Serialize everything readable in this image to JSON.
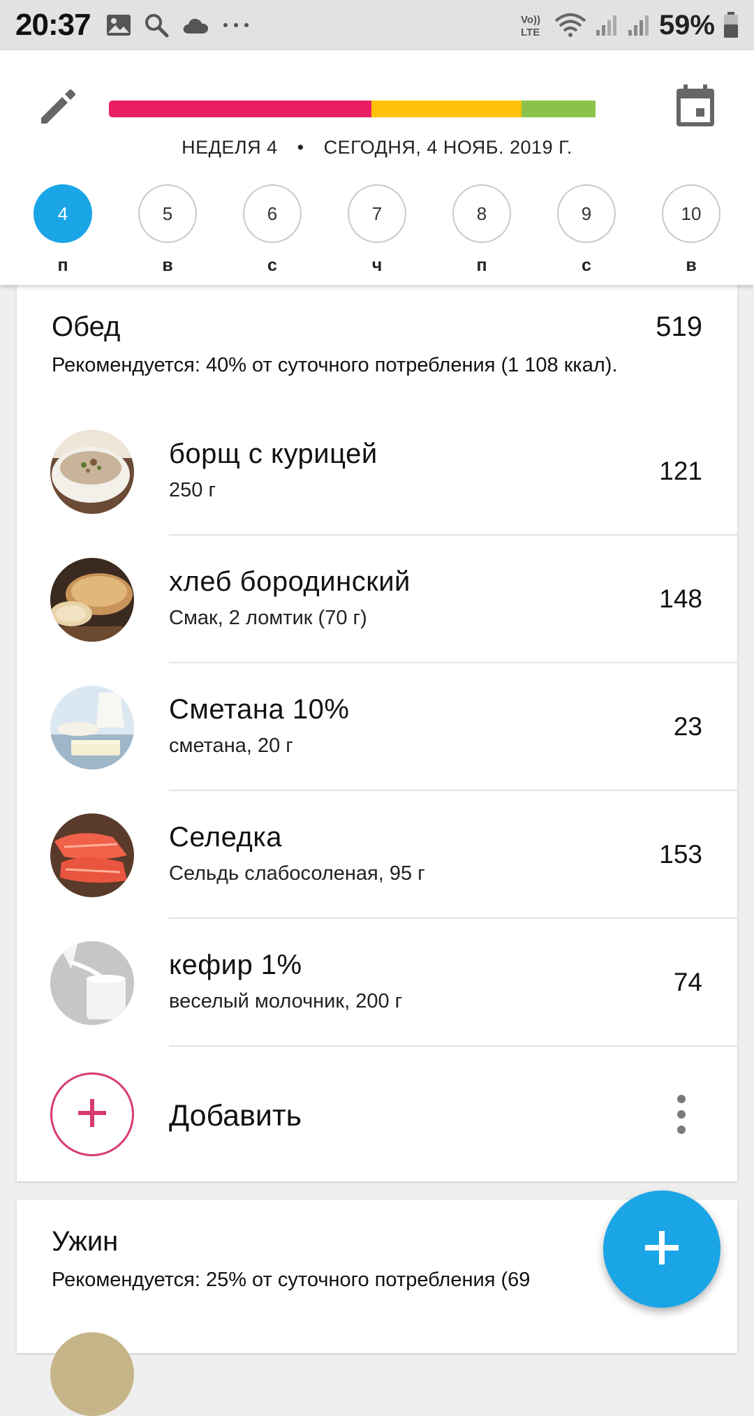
{
  "status_bar": {
    "time": "20:37",
    "battery_text": "59%",
    "network_label": "Vo)) LTE",
    "icons": [
      "image-icon",
      "search-icon",
      "cloud-icon",
      "more-dots-icon",
      "volte-icon",
      "wifi-icon",
      "signal-icon",
      "signal-icon",
      "battery-icon"
    ]
  },
  "header": {
    "edit_icon": "pencil-icon",
    "calendar_icon": "calendar-icon",
    "progress": {
      "segments": [
        {
          "color": "#e91e63",
          "fraction": 0.489
        },
        {
          "color": "#ffc107",
          "fraction": 0.28
        },
        {
          "color": "#8bc34a",
          "fraction": 0.138
        }
      ]
    },
    "week_label": "НЕДЕЛЯ 4",
    "separator": "•",
    "date_label": "СЕГОДНЯ, 4 НОЯБ. 2019 Г.",
    "days": [
      {
        "num": "4",
        "label": "п",
        "active": true
      },
      {
        "num": "5",
        "label": "в",
        "active": false
      },
      {
        "num": "6",
        "label": "с",
        "active": false
      },
      {
        "num": "7",
        "label": "ч",
        "active": false
      },
      {
        "num": "8",
        "label": "п",
        "active": false
      },
      {
        "num": "9",
        "label": "с",
        "active": false
      },
      {
        "num": "10",
        "label": "в",
        "active": false
      }
    ]
  },
  "lunch": {
    "title": "Обед",
    "total": "519",
    "recommendation": "Рекомендуется: 40% от суточного потребления (1 108 ккал).",
    "items": [
      {
        "name": "борщ с курицей",
        "sub": "250 г",
        "value": "121"
      },
      {
        "name": "хлеб бородинский",
        "sub": "Смак, 2 ломтик (70 г)",
        "value": "148"
      },
      {
        "name": "Сметана 10%",
        "sub": "сметана, 20 г",
        "value": "23"
      },
      {
        "name": "Селедка",
        "sub": "Сельдь слабосоленая, 95 г",
        "value": "153"
      },
      {
        "name": "кефир 1%",
        "sub": "веселый молочник, 200 г",
        "value": "74"
      }
    ],
    "add_label": "Добавить"
  },
  "dinner": {
    "title": "Ужин",
    "recommendation": "Рекомендуется: 25% от суточного потребления (69"
  },
  "colors": {
    "accent": "#1aa5e6",
    "add_ring": "#d63b6e"
  }
}
